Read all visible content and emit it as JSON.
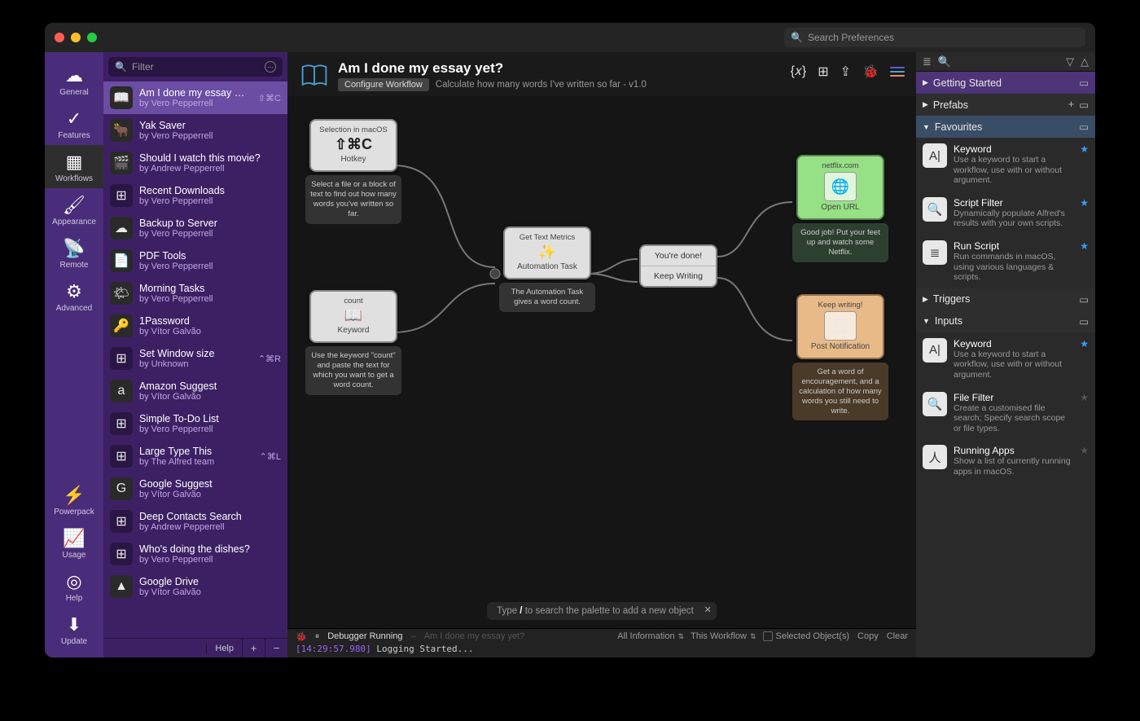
{
  "titlebar": {
    "search_placeholder": "Search Preferences"
  },
  "left_sidebar": {
    "items": [
      {
        "label": "General",
        "icon": "☁"
      },
      {
        "label": "Features",
        "icon": "✓"
      },
      {
        "label": "Workflows",
        "icon": "▦"
      },
      {
        "label": "Appearance",
        "icon": "🖌"
      },
      {
        "label": "Remote",
        "icon": "📡"
      },
      {
        "label": "Advanced",
        "icon": "⚙"
      }
    ],
    "bottom_items": [
      {
        "label": "Powerpack",
        "icon": "⚡"
      },
      {
        "label": "Usage",
        "icon": "📈"
      },
      {
        "label": "Help",
        "icon": "◎"
      },
      {
        "label": "Update",
        "icon": "⬇"
      }
    ],
    "selected_index": 2
  },
  "workflow_filter": {
    "placeholder": "Filter"
  },
  "workflows": [
    {
      "title": "Am I done my essay yet?",
      "author": "by Vero Pepperrell",
      "icon": "📖",
      "hotkey": "⇧⌘C"
    },
    {
      "title": "Yak Saver",
      "author": "by Vero Pepperrell",
      "icon": "🐂",
      "hotkey": ""
    },
    {
      "title": "Should I watch this movie?",
      "author": "by Andrew Pepperrell",
      "icon": "🎬",
      "hotkey": ""
    },
    {
      "title": "Recent Downloads",
      "author": "by Vero Pepperrell",
      "icon": "",
      "hotkey": ""
    },
    {
      "title": "Backup to Server",
      "author": "by Vero Pepperrell",
      "icon": "☁",
      "hotkey": ""
    },
    {
      "title": "PDF Tools",
      "author": "by Vero Pepperrell",
      "icon": "📄",
      "hotkey": ""
    },
    {
      "title": "Morning Tasks",
      "author": "by Vero Pepperrell",
      "icon": "🌤",
      "hotkey": ""
    },
    {
      "title": "1Password",
      "author": "by Vítor Galvão",
      "icon": "🔑",
      "hotkey": ""
    },
    {
      "title": "Set Window size",
      "author": "by Unknown",
      "icon": "",
      "hotkey": "⌃⌘R"
    },
    {
      "title": "Amazon Suggest",
      "author": "by Vítor Galvão",
      "icon": "a",
      "hotkey": ""
    },
    {
      "title": "Simple To-Do List",
      "author": "by Vero Pepperrell",
      "icon": "",
      "hotkey": ""
    },
    {
      "title": "Large Type This",
      "author": "by The Alfred team",
      "icon": "",
      "hotkey": "⌃⌘L"
    },
    {
      "title": "Google Suggest",
      "author": "by Vítor Galvão",
      "icon": "G",
      "hotkey": ""
    },
    {
      "title": "Deep Contacts Search",
      "author": "by Andrew Pepperrell",
      "icon": "",
      "hotkey": ""
    },
    {
      "title": "Who's doing the dishes?",
      "author": "by Vero Pepperrell",
      "icon": "",
      "hotkey": ""
    },
    {
      "title": "Google Drive",
      "author": "by Vítor Galvão",
      "icon": "▲",
      "hotkey": ""
    }
  ],
  "workflow_selected_index": 0,
  "workflow_toolbar": {
    "help": "Help",
    "add": "+",
    "remove": "−"
  },
  "header": {
    "title": "Am I done my essay yet?",
    "configure_label": "Configure Workflow",
    "subtitle": "Calculate how many words I've written so far - v1.0"
  },
  "canvas": {
    "nodes": {
      "hotkey": {
        "top": "Selection in macOS",
        "center": "⇧⌘C",
        "bottom": "Hotkey",
        "desc": "Select a file or a block of text to find out how many words you've written so far."
      },
      "keyword": {
        "top": "count",
        "center": "📖",
        "bottom": "Keyword",
        "desc": "Use the keyword \"count\" and paste the text for which you want to get a word count."
      },
      "automation": {
        "top": "Get Text Metrics",
        "center": "✨",
        "bottom": "Automation Task",
        "desc": "The Automation Task gives a word count."
      },
      "split": {
        "top": "You're done!",
        "bottom": "Keep Writing"
      },
      "openurl": {
        "top": "netflix.com",
        "center": "🌐",
        "bottom": "Open URL",
        "desc": "Good job! Put your feet up and watch some Netflix."
      },
      "notify": {
        "top": "Keep writing!",
        "center": "🗒",
        "bottom": "Post Notification",
        "desc": "Get a word of encouragement, and a calculation of how many words you still need to write."
      }
    },
    "palette_hint_prefix": "Type ",
    "palette_hint_slash": "/",
    "palette_hint_suffix": " to search the palette to add a new object"
  },
  "debugger": {
    "status": "Debugger Running",
    "context": "Am I done my essay yet?",
    "filter1": "All Information",
    "filter2": "This Workflow",
    "selected_objects": "Selected Object(s)",
    "copy": "Copy",
    "clear": "Clear",
    "log_ts": "[14:29:57.980]",
    "log_msg": "Logging Started..."
  },
  "palette": {
    "sections": {
      "getting_started": "Getting Started",
      "prefabs": "Prefabs",
      "favourites": "Favourites",
      "triggers": "Triggers",
      "inputs": "Inputs"
    },
    "favourites": [
      {
        "title": "Keyword",
        "desc": "Use a keyword to start a workflow, use with or without argument.",
        "icon": "A|",
        "starred": true
      },
      {
        "title": "Script Filter",
        "desc": "Dynamically populate Alfred's results with your own scripts.",
        "icon": "🔍",
        "starred": true
      },
      {
        "title": "Run Script",
        "desc": "Run commands in macOS, using various languages & scripts.",
        "icon": "≣",
        "starred": true
      }
    ],
    "inputs": [
      {
        "title": "Keyword",
        "desc": "Use a keyword to start a workflow, use with or without argument.",
        "icon": "A|",
        "starred": true
      },
      {
        "title": "File Filter",
        "desc": "Create a customised file search; Specify search scope or file types.",
        "icon": "🔍",
        "starred": false
      },
      {
        "title": "Running Apps",
        "desc": "Show a list of currently running apps in macOS.",
        "icon": "人",
        "starred": false
      }
    ]
  }
}
